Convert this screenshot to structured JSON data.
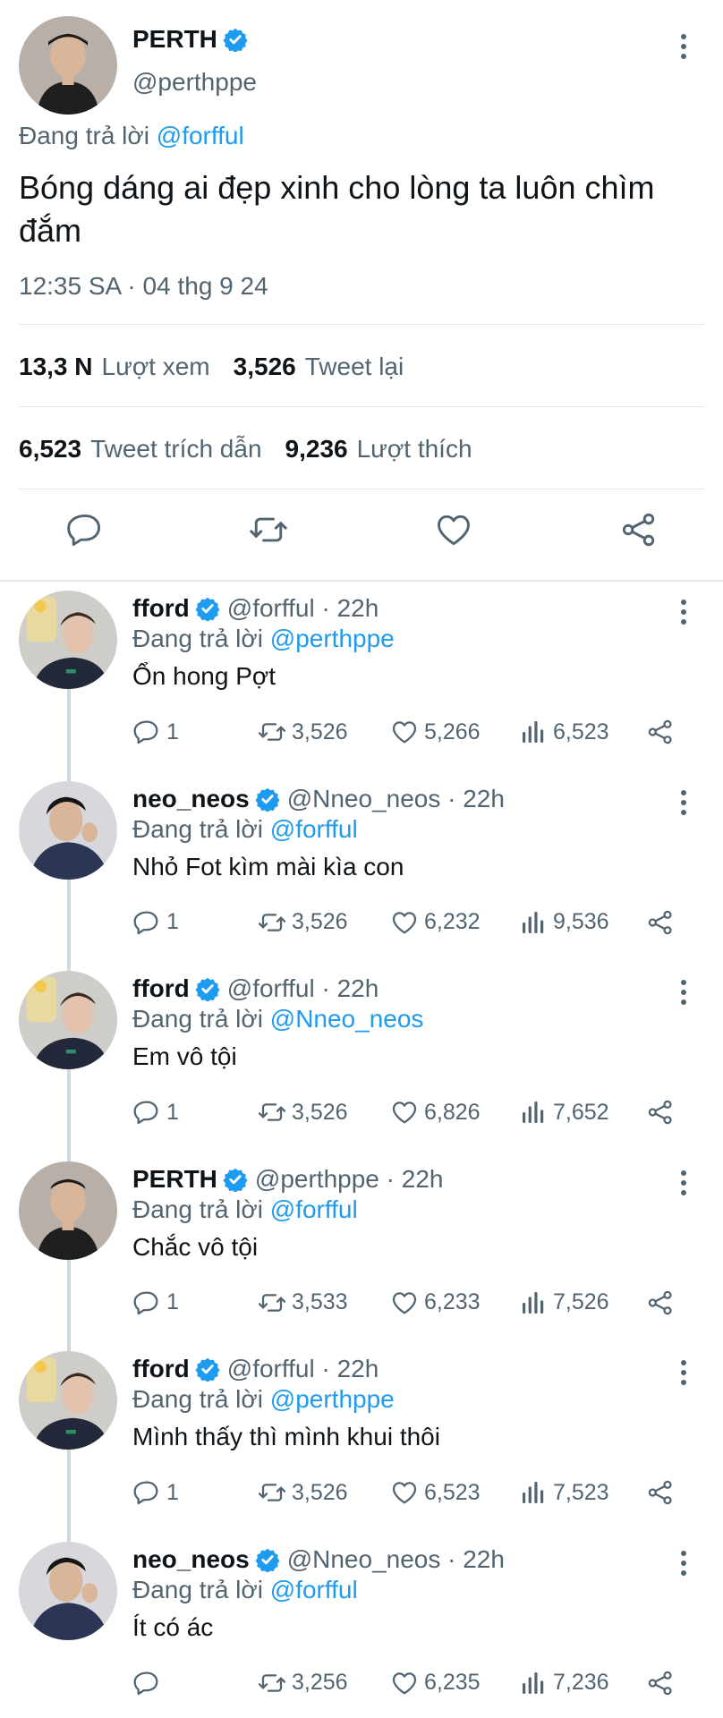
{
  "main_tweet": {
    "author_name": "PERTH",
    "handle": "@perthppe",
    "reply_prefix": "Đang trả lời",
    "reply_to": "@forfful",
    "text": "Bóng dáng ai đẹp xinh cho lòng ta luôn chìm đắm",
    "timestamp": "12:35 SA · 04 thg 9 24",
    "views_count": "13,3 N",
    "views_label": "Lượt xem",
    "retweets_count": "3,526",
    "retweets_label": "Tweet lại",
    "quotes_count": "6,523",
    "quotes_label": "Tweet trích dẫn",
    "likes_count": "9,236",
    "likes_label": "Lượt thích",
    "actions": [
      "reply-icon",
      "retweet-icon",
      "like-icon",
      "share-icon"
    ]
  },
  "replies": [
    {
      "name": "fford",
      "meta": "@forfful · 22h",
      "reply_prefix": "Đang trả lời",
      "reply_to": "@perthppe",
      "text": "Ổn hong Pợt",
      "comments": "1",
      "retweets": "3,526",
      "likes": "5,266",
      "views": "6,523"
    },
    {
      "name": "neo_neos",
      "meta": "@Nneo_neos · 22h",
      "reply_prefix": "Đang trả lời",
      "reply_to": "@forfful",
      "text": "Nhỏ Fot kìm mài kìa con",
      "comments": "1",
      "retweets": "3,526",
      "likes": "6,232",
      "views": "9,536"
    },
    {
      "name": "fford",
      "meta": "@forfful · 22h",
      "reply_prefix": "Đang trả lời",
      "reply_to": "@Nneo_neos",
      "text": "Em vô tội",
      "comments": "1",
      "retweets": "3,526",
      "likes": "6,826",
      "views": "7,652"
    },
    {
      "name": "PERTH",
      "meta": "@perthppe · 22h",
      "reply_prefix": "Đang trả lời",
      "reply_to": "@forfful",
      "text": "Chắc vô tội",
      "comments": "1",
      "retweets": "3,533",
      "likes": "6,233",
      "views": "7,526"
    },
    {
      "name": "fford",
      "meta": "@forfful · 22h",
      "reply_prefix": "Đang trả lời",
      "reply_to": "@perthppe",
      "text": "Mình thấy thì mình khui thôi",
      "comments": "1",
      "retweets": "3,526",
      "likes": "6,523",
      "views": "7,523"
    },
    {
      "name": "neo_neos",
      "meta": "@Nneo_neos · 22h",
      "reply_prefix": "Đang trả lời",
      "reply_to": "@forfful",
      "text": "Ít có ác",
      "comments": "",
      "retweets": "3,256",
      "likes": "6,235",
      "views": "7,236"
    }
  ],
  "colors": {
    "accent": "#1d9bf0",
    "text": "#0f1419",
    "muted": "#536471",
    "divider": "#e1e6ea"
  }
}
